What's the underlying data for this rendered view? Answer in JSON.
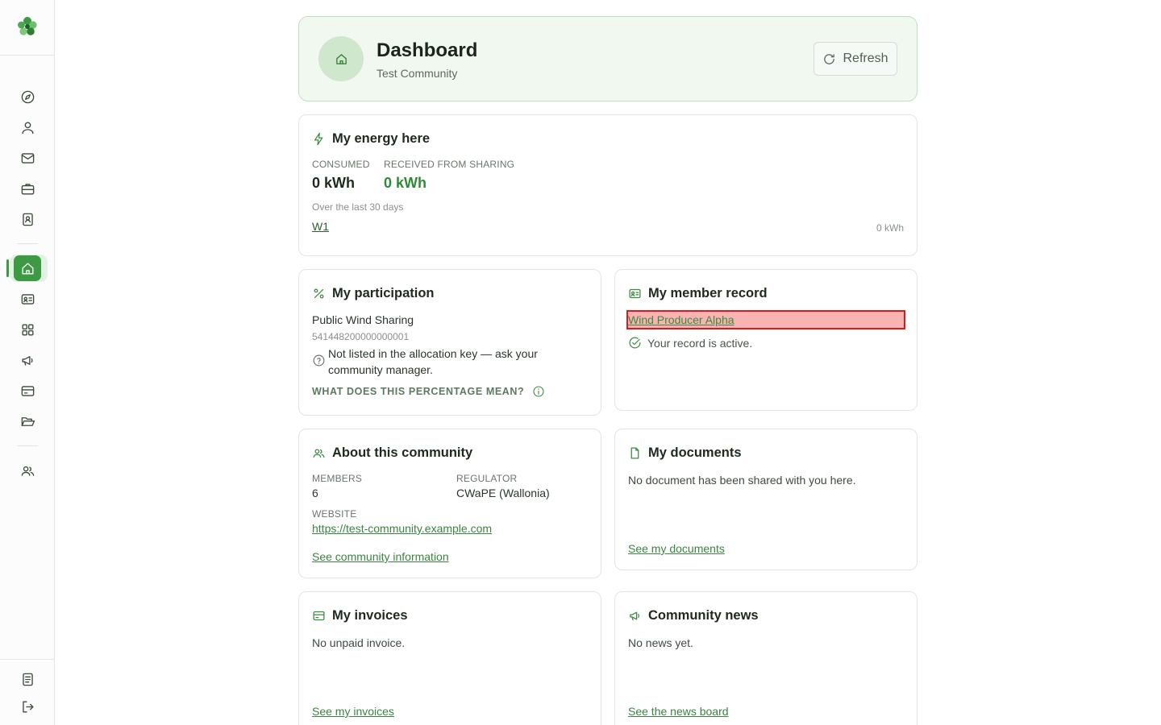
{
  "sidebar": {
    "logo": "flower-logo",
    "nav_top": [
      "compass-icon",
      "user-icon",
      "mail-icon",
      "briefcase-icon",
      "contact-book-icon"
    ],
    "nav_middle": [
      "home-icon",
      "id-card-icon",
      "grid-icon",
      "megaphone-icon",
      "credit-card-icon",
      "folder-open-icon"
    ],
    "nav_bottom": [
      "users-icon"
    ],
    "footer": [
      "document-icon",
      "logout-icon"
    ],
    "accent": "#3c9a42"
  },
  "header": {
    "title": "Dashboard",
    "subtitle": "Test Community",
    "refresh_label": "Refresh"
  },
  "energy": {
    "title": "My energy here",
    "consumed_label": "CONSUMED",
    "consumed_value": "0 kWh",
    "received_label": "RECEIVED FROM SHARING",
    "received_value": "0 kWh",
    "period": "Over the last 30 days",
    "meter_link": "W1",
    "meter_value": "0 kWh"
  },
  "participation": {
    "title": "My participation",
    "name": "Public Wind Sharing",
    "ean": "541448200000000001",
    "notice": "Not listed in the allocation key — ask your community manager.",
    "help_link": "WHAT DOES THIS PERCENTAGE MEAN?"
  },
  "member_record": {
    "title": "My member record",
    "link": "Wind Producer Alpha",
    "status": "Your record is active."
  },
  "community": {
    "title": "About this community",
    "members_label": "MEMBERS",
    "members_value": "6",
    "regulator_label": "REGULATOR",
    "regulator_value": "CWaPE (Wallonia)",
    "website_label": "WEBSITE",
    "website_value": "https://test-community.example.com",
    "info_link": "See community information"
  },
  "documents": {
    "title": "My documents",
    "empty": "No document has been shared with you here.",
    "link": "See my documents"
  },
  "invoices": {
    "title": "My invoices",
    "empty": "No unpaid invoice.",
    "link": "See my invoices"
  },
  "news": {
    "title": "Community news",
    "empty": "No news yet.",
    "link": "See the news board"
  }
}
